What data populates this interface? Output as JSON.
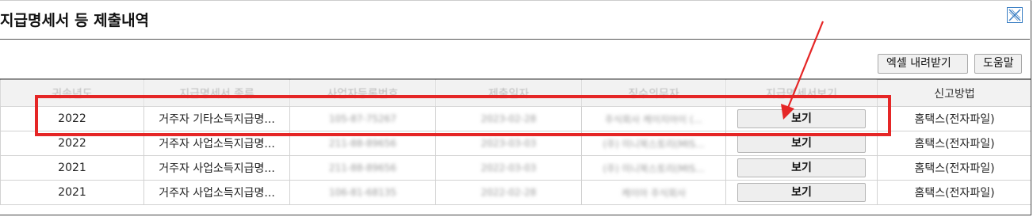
{
  "window": {
    "title": "지급명세서 등 제출내역"
  },
  "toolbar": {
    "excel_label": "엑셀 내려받기",
    "help_label": "도움말"
  },
  "table": {
    "columns": [
      "귀속년도",
      "지급명세서 종류",
      "사업자등록번호",
      "제출일자",
      "징수의무자",
      "지급명세서보기",
      "신고방법"
    ],
    "rows": [
      {
        "year": "2022",
        "type": "거주자 기타소득지급명...",
        "bizno": "105-87-75267",
        "date": "2023-02-28",
        "payer": "주식회사 케이지아이 (...",
        "view": "보기",
        "method": "홈택스(전자파일)"
      },
      {
        "year": "2022",
        "type": "거주자 사업소득지급명...",
        "bizno": "211-88-89656",
        "date": "2023-03-03",
        "payer": "(주) 미니북스토리(MIS...",
        "view": "보기",
        "method": "홈택스(전자파일)"
      },
      {
        "year": "2021",
        "type": "거주자 사업소득지급명...",
        "bizno": "211-88-89656",
        "date": "2022-03-03",
        "payer": "(주) 미니북스토리(MIS...",
        "view": "보기",
        "method": "홈택스(전자파일)"
      },
      {
        "year": "2021",
        "type": "거주자 사업소득지급명...",
        "bizno": "106-81-68135",
        "date": "2022-02-28",
        "payer": "케이아 주식회사",
        "view": "보기",
        "method": "홈택스(전자파일)"
      }
    ]
  },
  "annotation": {
    "color": "#e52626"
  }
}
